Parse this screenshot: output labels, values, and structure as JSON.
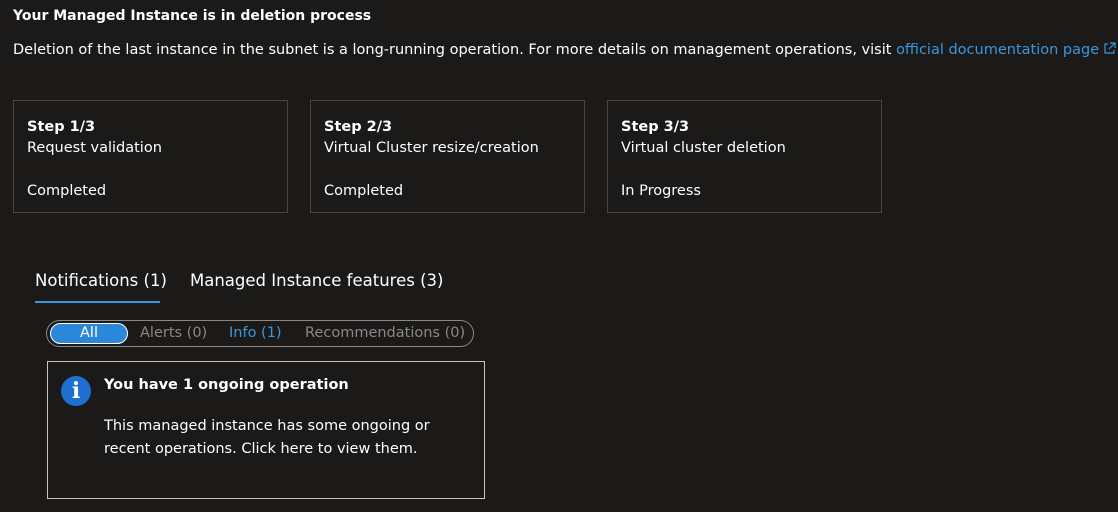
{
  "header": {
    "title": "Your Managed Instance is in deletion process",
    "description": "Deletion of the last instance in the subnet is a long-running operation. For more details on management operations, visit ",
    "link_text": "official documentation page"
  },
  "steps": [
    {
      "num": "Step 1/3",
      "name": "Request validation",
      "status": "Completed"
    },
    {
      "num": "Step 2/3",
      "name": "Virtual Cluster resize/creation",
      "status": "Completed"
    },
    {
      "num": "Step 3/3",
      "name": "Virtual cluster deletion",
      "status": "In Progress"
    }
  ],
  "tabs": [
    {
      "label": "Notifications (1)",
      "active": true
    },
    {
      "label": "Managed Instance features (3)",
      "active": false
    }
  ],
  "filters": {
    "all": "All",
    "alerts": "Alerts (0)",
    "info": "Info (1)",
    "recommendations": "Recommendations (0)",
    "selected": "All"
  },
  "notification": {
    "icon": "info-icon",
    "title": "You have 1 ongoing operation",
    "body": "This managed instance has some ongoing or recent operations. Click here to view them."
  },
  "colors": {
    "background": "#1b1a19",
    "link": "#3a96dd",
    "selected_pill": "#2b88d8",
    "info_icon": "#1f6fd1"
  }
}
